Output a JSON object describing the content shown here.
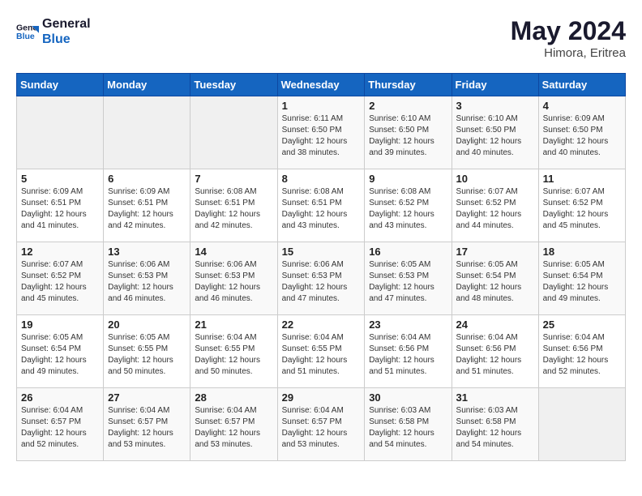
{
  "header": {
    "logo_line1": "General",
    "logo_line2": "Blue",
    "month_year": "May 2024",
    "location": "Himora, Eritrea"
  },
  "days_of_week": [
    "Sunday",
    "Monday",
    "Tuesday",
    "Wednesday",
    "Thursday",
    "Friday",
    "Saturday"
  ],
  "weeks": [
    [
      {
        "num": "",
        "info": ""
      },
      {
        "num": "",
        "info": ""
      },
      {
        "num": "",
        "info": ""
      },
      {
        "num": "1",
        "info": "Sunrise: 6:11 AM\nSunset: 6:50 PM\nDaylight: 12 hours\nand 38 minutes."
      },
      {
        "num": "2",
        "info": "Sunrise: 6:10 AM\nSunset: 6:50 PM\nDaylight: 12 hours\nand 39 minutes."
      },
      {
        "num": "3",
        "info": "Sunrise: 6:10 AM\nSunset: 6:50 PM\nDaylight: 12 hours\nand 40 minutes."
      },
      {
        "num": "4",
        "info": "Sunrise: 6:09 AM\nSunset: 6:50 PM\nDaylight: 12 hours\nand 40 minutes."
      }
    ],
    [
      {
        "num": "5",
        "info": "Sunrise: 6:09 AM\nSunset: 6:51 PM\nDaylight: 12 hours\nand 41 minutes."
      },
      {
        "num": "6",
        "info": "Sunrise: 6:09 AM\nSunset: 6:51 PM\nDaylight: 12 hours\nand 42 minutes."
      },
      {
        "num": "7",
        "info": "Sunrise: 6:08 AM\nSunset: 6:51 PM\nDaylight: 12 hours\nand 42 minutes."
      },
      {
        "num": "8",
        "info": "Sunrise: 6:08 AM\nSunset: 6:51 PM\nDaylight: 12 hours\nand 43 minutes."
      },
      {
        "num": "9",
        "info": "Sunrise: 6:08 AM\nSunset: 6:52 PM\nDaylight: 12 hours\nand 43 minutes."
      },
      {
        "num": "10",
        "info": "Sunrise: 6:07 AM\nSunset: 6:52 PM\nDaylight: 12 hours\nand 44 minutes."
      },
      {
        "num": "11",
        "info": "Sunrise: 6:07 AM\nSunset: 6:52 PM\nDaylight: 12 hours\nand 45 minutes."
      }
    ],
    [
      {
        "num": "12",
        "info": "Sunrise: 6:07 AM\nSunset: 6:52 PM\nDaylight: 12 hours\nand 45 minutes."
      },
      {
        "num": "13",
        "info": "Sunrise: 6:06 AM\nSunset: 6:53 PM\nDaylight: 12 hours\nand 46 minutes."
      },
      {
        "num": "14",
        "info": "Sunrise: 6:06 AM\nSunset: 6:53 PM\nDaylight: 12 hours\nand 46 minutes."
      },
      {
        "num": "15",
        "info": "Sunrise: 6:06 AM\nSunset: 6:53 PM\nDaylight: 12 hours\nand 47 minutes."
      },
      {
        "num": "16",
        "info": "Sunrise: 6:05 AM\nSunset: 6:53 PM\nDaylight: 12 hours\nand 47 minutes."
      },
      {
        "num": "17",
        "info": "Sunrise: 6:05 AM\nSunset: 6:54 PM\nDaylight: 12 hours\nand 48 minutes."
      },
      {
        "num": "18",
        "info": "Sunrise: 6:05 AM\nSunset: 6:54 PM\nDaylight: 12 hours\nand 49 minutes."
      }
    ],
    [
      {
        "num": "19",
        "info": "Sunrise: 6:05 AM\nSunset: 6:54 PM\nDaylight: 12 hours\nand 49 minutes."
      },
      {
        "num": "20",
        "info": "Sunrise: 6:05 AM\nSunset: 6:55 PM\nDaylight: 12 hours\nand 50 minutes."
      },
      {
        "num": "21",
        "info": "Sunrise: 6:04 AM\nSunset: 6:55 PM\nDaylight: 12 hours\nand 50 minutes."
      },
      {
        "num": "22",
        "info": "Sunrise: 6:04 AM\nSunset: 6:55 PM\nDaylight: 12 hours\nand 51 minutes."
      },
      {
        "num": "23",
        "info": "Sunrise: 6:04 AM\nSunset: 6:56 PM\nDaylight: 12 hours\nand 51 minutes."
      },
      {
        "num": "24",
        "info": "Sunrise: 6:04 AM\nSunset: 6:56 PM\nDaylight: 12 hours\nand 51 minutes."
      },
      {
        "num": "25",
        "info": "Sunrise: 6:04 AM\nSunset: 6:56 PM\nDaylight: 12 hours\nand 52 minutes."
      }
    ],
    [
      {
        "num": "26",
        "info": "Sunrise: 6:04 AM\nSunset: 6:57 PM\nDaylight: 12 hours\nand 52 minutes."
      },
      {
        "num": "27",
        "info": "Sunrise: 6:04 AM\nSunset: 6:57 PM\nDaylight: 12 hours\nand 53 minutes."
      },
      {
        "num": "28",
        "info": "Sunrise: 6:04 AM\nSunset: 6:57 PM\nDaylight: 12 hours\nand 53 minutes."
      },
      {
        "num": "29",
        "info": "Sunrise: 6:04 AM\nSunset: 6:57 PM\nDaylight: 12 hours\nand 53 minutes."
      },
      {
        "num": "30",
        "info": "Sunrise: 6:03 AM\nSunset: 6:58 PM\nDaylight: 12 hours\nand 54 minutes."
      },
      {
        "num": "31",
        "info": "Sunrise: 6:03 AM\nSunset: 6:58 PM\nDaylight: 12 hours\nand 54 minutes."
      },
      {
        "num": "",
        "info": ""
      }
    ]
  ]
}
